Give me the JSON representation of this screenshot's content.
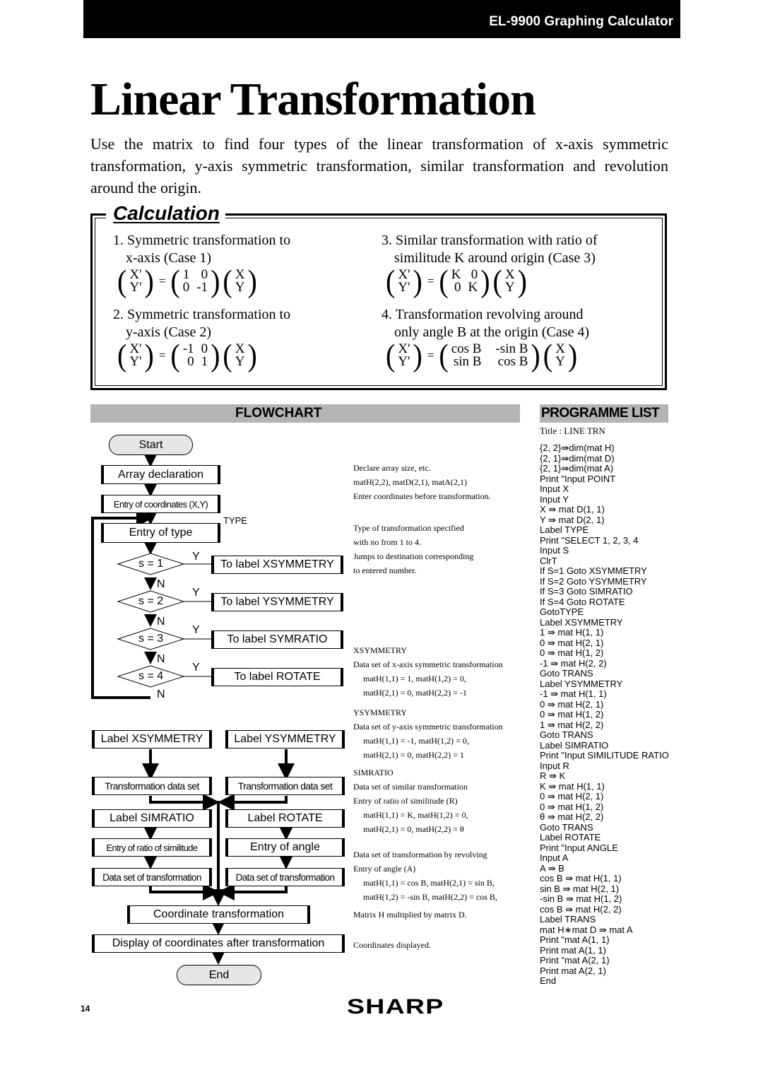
{
  "header": {
    "title": "EL-9900 Graphing Calculator"
  },
  "page_title": "Linear Transformation",
  "intro": "Use the matrix to find four types of the linear transformation of x-axis symmetric transformation, y-axis symmetric transformation, similar transformation and revolution around the origin.",
  "calculation": {
    "title": "Calculation",
    "cases": [
      {
        "line1": "1. Symmetric transformation to",
        "line2": "x-axis (Case 1)",
        "lhs": [
          "X'",
          "Y'"
        ],
        "matrix": [
          "1",
          "0",
          "0",
          "-1"
        ],
        "rhs": [
          "X",
          "Y"
        ]
      },
      {
        "line1": "2. Symmetric transformation to",
        "line2": "y-axis (Case 2)",
        "lhs": [
          "X'",
          "Y'"
        ],
        "matrix": [
          "-1",
          "0",
          "0",
          "1"
        ],
        "rhs": [
          "X",
          "Y"
        ]
      },
      {
        "line1": "3. Similar transformation with ratio of",
        "line2": "similitude K around origin (Case 3)",
        "lhs": [
          "X'",
          "Y'"
        ],
        "matrix": [
          "K",
          "0",
          "0",
          "K"
        ],
        "rhs": [
          "X",
          "Y"
        ]
      },
      {
        "line1": "4. Transformation revolving around",
        "line2": "only angle B at the origin (Case 4)",
        "lhs": [
          "X'",
          "Y'"
        ],
        "matrix": [
          "cos B",
          "-sin B",
          "sin B",
          "cos B"
        ],
        "rhs": [
          "X",
          "Y"
        ]
      }
    ],
    "equals": "="
  },
  "flowchart": {
    "title": "FLOWCHART",
    "start": "Start",
    "array_decl": "Array declaration",
    "entry_coords": "Entry of coordinates (X,Y)",
    "type_label": "TYPE",
    "entry_type": "Entry of type",
    "decisions": [
      {
        "cond": "s = 1",
        "yes": "Y",
        "no": "N",
        "target": "To label XSYMMETRY"
      },
      {
        "cond": "s = 2",
        "yes": "Y",
        "no": "N",
        "target": "To label YSYMMETRY"
      },
      {
        "cond": "s = 3",
        "yes": "Y",
        "no": "N",
        "target": "To label SYMRATIO"
      },
      {
        "cond": "s = 4",
        "yes": "Y",
        "no": "N",
        "target": "To label ROTATE"
      }
    ],
    "label_xsym": "Label  XSYMMETRY",
    "label_ysym": "Label  YSYMMETRY",
    "trans_data_set_1": "Transformation data set",
    "trans_data_set_2": "Transformation data set",
    "label_simratio": "Label  SIMRATIO",
    "label_rotate": "Label  ROTATE",
    "entry_ratio": "Entry of ratio of similitude",
    "entry_angle": "Entry of angle",
    "data_set_trans_1": "Data set of transformation",
    "data_set_trans_2": "Data set of transformation",
    "coord_trans": "Coordinate transformation",
    "display_coords": "Display of coordinates after transformation",
    "end": "End"
  },
  "notes": {
    "declare": "Declare array size, etc.",
    "declare_detail": "matH(2,2), matD(2,1), matA(2,1)",
    "enter_coords": "Enter coordinates before transformation.",
    "type_spec_1": "Type of transformation specified",
    "type_spec_2": "with no from 1 to 4.",
    "jumps_1": "Jumps to destination corresponding",
    "jumps_2": "to entered number.",
    "xsym_head": "XSYMMETRY",
    "xsym_desc": "Data set of x-axis symmetric transformation",
    "xsym_l1": "matH(1,1) = 1, matH(1,2) = 0,",
    "xsym_l2": "matH(2,1) = 0, matH(2,2) = -1",
    "ysym_head": "YSYMMETRY",
    "ysym_desc": "Data set of y-axis symmetric transformation",
    "ysym_l1": "matH(1,1) = -1, matH(1,2) = 0,",
    "ysym_l2": "matH(2,1) = 0, matH(2,2) = 1",
    "sim_head": "SIMRATIO",
    "sim_desc": "Data set of similar transformation",
    "sim_entry": "Entry of ratio of similitude (R)",
    "sim_l1": "matH(1,1) = K, matH(1,2) = 0,",
    "sim_l2": "matH(2,1) = 0, matH(2,2) = θ",
    "rot_desc": "Data set of transformation by revolving",
    "rot_entry": "Entry of angle (A)",
    "rot_l1": "matH(1,1) = cos B, matH(2,1) = sin B,",
    "rot_l2": "matH(1,2) = -sin B, matH(2,2) = cos B,",
    "multiply": "Matrix H  multiplied by matrix D.",
    "displayed": "Coordinates displayed."
  },
  "programme": {
    "title": "PROGRAMME LIST",
    "program_title": "Title : LINE TRN",
    "lines": [
      "{2, 2}⇛dim(mat H)",
      "{2, 1}⇛dim(mat D)",
      "{2, 1}⇛dim(mat A)",
      "Print \"Input POINT",
      "Input X",
      "Input Y",
      "X ⇛ mat D(1, 1)",
      "Y ⇛ mat D(2, 1)",
      "Label TYPE",
      "Print \"SELECT 1, 2, 3, 4",
      "Input S",
      "ClrT",
      "If S=1 Goto XSYMMETRY",
      "If S=2 Goto YSYMMETRY",
      "If S=3 Goto SIMRATIO",
      "If S=4 Goto ROTATE",
      "GotoTYPE",
      "Label XSYMMETRY",
      "1 ⇛ mat H(1, 1)",
      "0 ⇛ mat H(2, 1)",
      "0 ⇛ mat H(1, 2)",
      "-1 ⇛ mat H(2, 2)",
      "Goto TRANS",
      "Label YSYMMETRY",
      "-1 ⇛ mat H(1, 1)",
      "0 ⇛ mat H(2, 1)",
      "0 ⇛ mat H(1, 2)",
      "1 ⇛ mat H(2, 2)",
      "Goto TRANS",
      "Label SIMRATIO",
      "Print \"Input SIMILITUDE RATIO",
      "Input R",
      "R ⇛ K",
      "K ⇛ mat H(1, 1)",
      "0 ⇛ mat H(2, 1)",
      "0 ⇛ mat H(1, 2)",
      "θ ⇛ mat H(2, 2)",
      "Goto TRANS",
      "Label ROTATE",
      "Print \"Input ANGLE",
      "Input A",
      "A ⇛ B",
      "cos B ⇛ mat H(1, 1)",
      "sin B ⇛ mat H(2, 1)",
      "-sin B ⇛ mat H(1, 2)",
      "cos B ⇛ mat H(2, 2)",
      "Label TRANS",
      "mat H∗mat D ⇛ mat A",
      "Print \"mat A(1, 1)",
      "Print mat A(1, 1)",
      "Print \"mat A(2, 1)",
      "Print mat A(2, 1)",
      "End"
    ]
  },
  "footer": {
    "page_number": "14",
    "brand": "SHARP"
  }
}
